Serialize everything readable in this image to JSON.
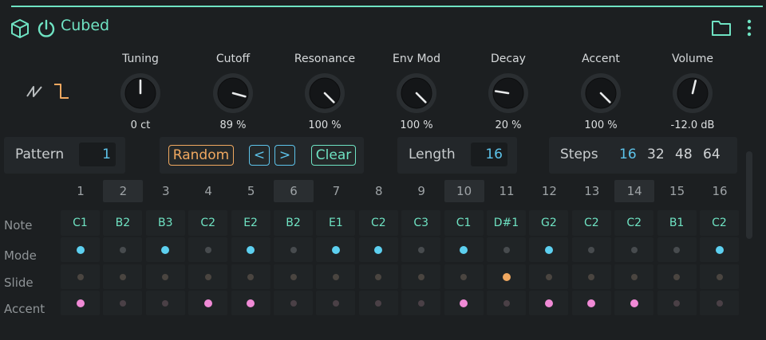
{
  "header": {
    "title": "Cubed",
    "accent_color": "#6fe3c3",
    "icons": [
      "cube-icon",
      "power-icon",
      "folder-icon",
      "kebab-menu-icon"
    ]
  },
  "waveforms": {
    "options": [
      "sawtooth-icon",
      "square-icon"
    ],
    "selected": "square"
  },
  "knobs": [
    {
      "label": "Tuning",
      "value": "0 ct",
      "level": 0.5
    },
    {
      "label": "Cutoff",
      "value": "89 %",
      "level": 0.89
    },
    {
      "label": "Resonance",
      "value": "100 %",
      "level": 1.0
    },
    {
      "label": "Env Mod",
      "value": "100 %",
      "level": 1.0
    },
    {
      "label": "Decay",
      "value": "20 %",
      "level": 0.2
    },
    {
      "label": "Accent",
      "value": "100 %",
      "level": 1.0
    },
    {
      "label": "Volume",
      "value": "-12.0 dB",
      "level": 0.55
    }
  ],
  "pattern": {
    "label": "Pattern",
    "value": "1"
  },
  "controls": {
    "random": "Random",
    "prev": "<",
    "next": ">",
    "clear": "Clear"
  },
  "length": {
    "label": "Length",
    "value": "16"
  },
  "steps": {
    "label": "Steps",
    "options": [
      "16",
      "32",
      "48",
      "64"
    ],
    "selected": "16"
  },
  "grid": {
    "columns": [
      "1",
      "2",
      "3",
      "4",
      "5",
      "6",
      "7",
      "8",
      "9",
      "10",
      "11",
      "12",
      "13",
      "14",
      "15",
      "16"
    ],
    "shaded_columns": [
      "2",
      "6",
      "10",
      "14"
    ],
    "row_labels": [
      "Note",
      "Mode",
      "Slide",
      "Accent"
    ],
    "notes": [
      "C1",
      "B2",
      "B3",
      "C2",
      "E2",
      "B2",
      "E1",
      "C2",
      "C3",
      "C1",
      "D#1",
      "G2",
      "C2",
      "C2",
      "B1",
      "C2"
    ],
    "mode": [
      1,
      0,
      1,
      0,
      1,
      0,
      1,
      1,
      0,
      1,
      0,
      1,
      0,
      0,
      0,
      1
    ],
    "slide": [
      0,
      0,
      0,
      0,
      0,
      0,
      0,
      0,
      0,
      0,
      1,
      0,
      0,
      0,
      0,
      0
    ],
    "accent": [
      1,
      0,
      0,
      1,
      1,
      0,
      0,
      0,
      0,
      1,
      0,
      1,
      1,
      1,
      0,
      0
    ],
    "colors": {
      "mode_on": "#5dd0f0",
      "slide_on": "#f0a860",
      "accent_on": "#f08ad6",
      "off": "#474b4e",
      "off_slide": "#4a4540",
      "off_accent": "#4a4046"
    }
  }
}
